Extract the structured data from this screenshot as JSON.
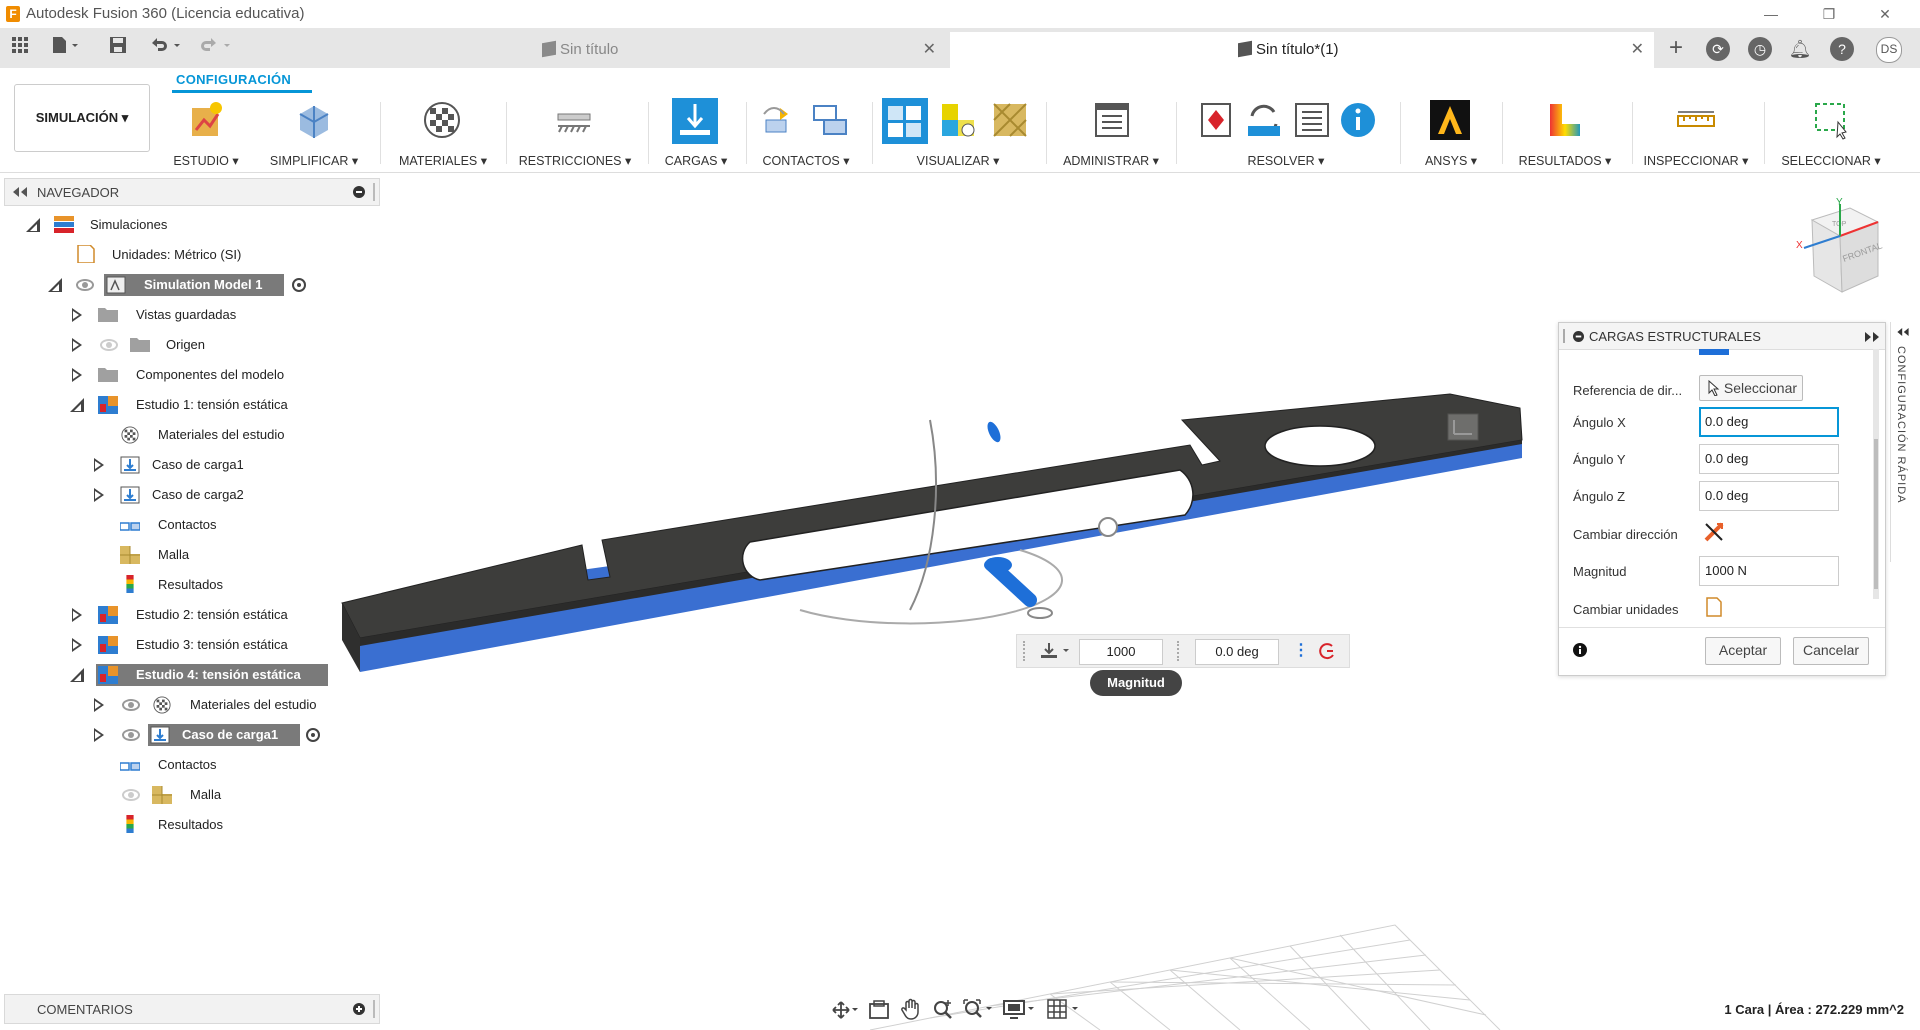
{
  "window": {
    "title": "Autodesk Fusion 360 (Licencia educativa)",
    "minimize": "—",
    "restore": "❐",
    "close": "✕"
  },
  "tabs": [
    {
      "label": "Sin título",
      "active": false
    },
    {
      "label": "Sin título*(1)",
      "active": true
    }
  ],
  "user": {
    "initials": "DS"
  },
  "ribbon": {
    "workspace": "SIMULACIÓN ▾",
    "active_tab": "CONFIGURACIÓN",
    "groups": [
      "ESTUDIO ▾",
      "SIMPLIFICAR ▾",
      "MATERIALES ▾",
      "RESTRICCIONES ▾",
      "CARGAS ▾",
      "CONTACTOS ▾",
      "VISUALIZAR ▾",
      "ADMINISTRAR ▾",
      "RESOLVER ▾",
      "ANSYS ▾",
      "RESULTADOS ▾",
      "INSPECCIONAR ▾",
      "SELECCIONAR ▾"
    ]
  },
  "browser": {
    "title": "NAVEGADOR",
    "items": [
      "Simulaciones",
      "Unidades: Métrico (SI)",
      "Simulation Model 1",
      "Vistas guardadas",
      "Origen",
      "Componentes del modelo",
      "Estudio 1: tensión estática",
      "Materiales del estudio",
      "Caso de carga1",
      "Caso de carga2",
      "Contactos",
      "Malla",
      "Resultados",
      "Estudio 2: tensión estática",
      "Estudio 3: tensión estática",
      "Estudio 4: tensión estática",
      "Materiales del estudio",
      "Caso de carga1",
      "Contactos",
      "Malla",
      "Resultados"
    ]
  },
  "comments": {
    "title": "COMENTARIOS"
  },
  "panel": {
    "title": "CARGAS ESTRUCTURALES",
    "ref_label": "Referencia de dir...",
    "select_button": "Seleccionar",
    "angle_x_label": "Ángulo X",
    "angle_x": "0.0 deg",
    "angle_y_label": "Ángulo Y",
    "angle_y": "0.0 deg",
    "angle_z_label": "Ángulo Z",
    "angle_z": "0.0 deg",
    "flip_label": "Cambiar dirección",
    "magnitude_label": "Magnitud",
    "magnitude": "1000 N",
    "units_label": "Cambiar unidades",
    "ok": "Aceptar",
    "cancel": "Cancelar"
  },
  "floating": {
    "value": "1000",
    "angle": "0.0 deg",
    "tooltip": "Magnitud"
  },
  "viewcube": {
    "top": "TOP",
    "front": "FRONTAL",
    "x_axis": "X",
    "y_axis": "Y"
  },
  "side_tab": "CONFIGURACIÓN RÁPIDA",
  "status": "1 Cara | Área : 272.229 mm^2",
  "colors": {
    "accent": "#0696d7",
    "body": "#3d3d3b",
    "face": "#3a6fd1"
  }
}
